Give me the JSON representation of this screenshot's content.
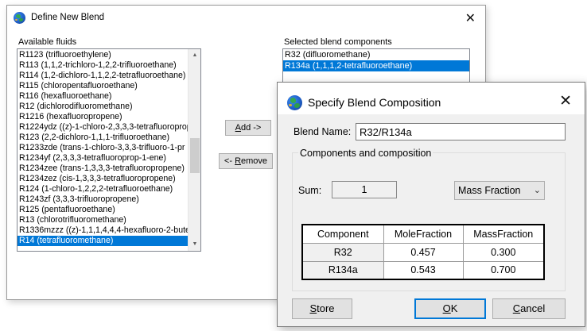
{
  "define_dialog": {
    "title": "Define New Blend",
    "close_glyph": "✕",
    "available_label": "Available fluids",
    "selected_label": "Selected blend components",
    "available_fluids": [
      "R1123 (trifluoroethylene)",
      "R113 (1,1,2-trichloro-1,2,2-trifluoroethane)",
      "R114 (1,2-dichloro-1,1,2,2-tetrafluoroethane)",
      "R115 (chloropentafluoroethane)",
      "R116 (hexafluoroethane)",
      "R12 (dichlorodifluoromethane)",
      "R1216 (hexafluoropropene)",
      "R1224ydz ((z)-1-chloro-2,3,3,3-tetrafluoroprop",
      "R123 (2,2-dichloro-1,1,1-trifluoroethane)",
      "R1233zde (trans-1-chloro-3,3,3-trifluoro-1-pr",
      "R1234yf (2,3,3,3-tetrafluoroprop-1-ene)",
      "R1234zee (trans-1,3,3,3-tetrafluoropropene)",
      "R1234zez (cis-1,3,3,3-tetrafluoropropene)",
      "R124 (1-chloro-1,2,2,2-tetrafluoroethane)",
      "R1243zf (3,3,3-trifluoropropene)",
      "R125 (pentafluoroethane)",
      "R13 (chlorotrifluoromethane)",
      "R1336mzzz ((z)-1,1,1,4,4,4-hexafluoro-2-bute",
      "R14 (tetrafluoromethane)"
    ],
    "available_selected_index": 18,
    "add_button": "Add ->",
    "remove_button": "<- Remove",
    "selected_components": [
      "R32 (difluoromethane)",
      "R134a (1,1,1,2-tetrafluoroethane)"
    ],
    "selected_components_selected_index": 1
  },
  "composition_dialog": {
    "title": "Specify Blend Composition",
    "close_glyph": "✕",
    "blend_name_label": "Blend Name:",
    "blend_name_value": "R32/R134a",
    "group_label": "Components and composition",
    "sum_label": "Sum:",
    "sum_value": "1",
    "fraction_select": "Mass Fraction",
    "table": {
      "headers": [
        "Component",
        "MoleFraction",
        "MassFraction"
      ],
      "rows": [
        [
          "R32",
          "0.457",
          "0.300"
        ],
        [
          "R134a",
          "0.543",
          "0.700"
        ]
      ]
    },
    "store_button": "Store",
    "ok_button": "OK",
    "cancel_button": "Cancel"
  },
  "colors": {
    "selection": "#0078d7",
    "dialog_bg": "#f0f0f0",
    "button_bg": "#e1e1e1"
  },
  "icons": [
    "globe-icon",
    "close-icon",
    "scroll-up-icon",
    "scroll-down-icon",
    "chevron-down-icon"
  ]
}
